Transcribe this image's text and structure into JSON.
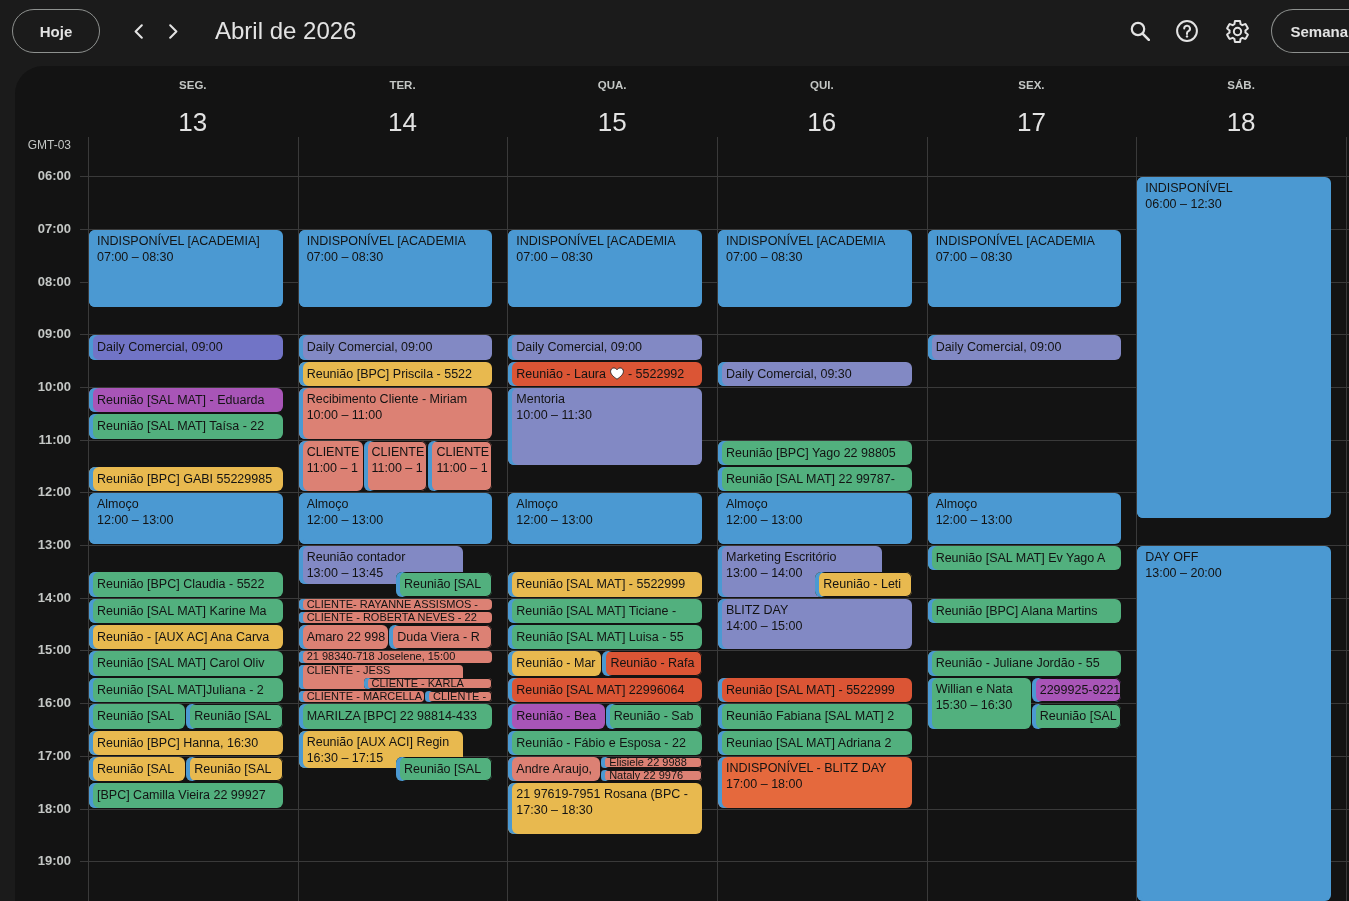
{
  "toolbar": {
    "today_button": "Hoje",
    "title": "Abril de 2026",
    "view_button": "Semana"
  },
  "timezone": "GMT-03",
  "time_labels": [
    "06:00",
    "07:00",
    "08:00",
    "09:00",
    "10:00",
    "11:00",
    "12:00",
    "13:00",
    "14:00",
    "15:00",
    "16:00",
    "17:00",
    "18:00",
    "19:00"
  ],
  "days": [
    {
      "weekday": "SEG.",
      "date": "13",
      "items": [
        {
          "kind": "free-hour"
        },
        {
          "kind": "hour-and-half",
          "title": "INDISPONÍVEL [ACADEMIA]",
          "time": "07:00 – 08:30",
          "color": "#4b99d2"
        },
        {
          "kind": "free-half-hour"
        },
        {
          "kind": "half-hour",
          "title": "Daily Comercial, 09:00",
          "color": "#7174c6"
        },
        {
          "kind": "free-half-hour"
        },
        {
          "kind": "half-hour",
          "title": "Reunião [SAL MAT] - Eduarda",
          "color": "#a855b7"
        },
        {
          "kind": "half-hour",
          "title": "Reunião [SAL MAT] Taísa - 22",
          "color": "#52b07e"
        },
        {
          "kind": "free-half-hour"
        },
        {
          "kind": "half-hour",
          "title": "Reunião [BPC] GABI 55229985",
          "color": "#e8b94f"
        },
        {
          "kind": "hour",
          "title": "Almoço",
          "time": "12:00 – 13:00",
          "color": "#4b99d2"
        },
        {
          "kind": "free-half-hour"
        },
        {
          "kind": "half-hour",
          "title": "Reunião [BPC] Claudia - 5522",
          "color": "#52b07e"
        },
        {
          "kind": "half-hour",
          "title": "Reunião [SAL MAT] Karine Ma",
          "color": "#52b07e"
        },
        {
          "kind": "half-hour",
          "title": "Reunião - [AUX AC] Ana Carva",
          "color": "#e8b94f"
        },
        {
          "kind": "half-hour",
          "title": "Reunião [SAL MAT] Carol Oliv",
          "color": "#52b07e"
        },
        {
          "kind": "half-hour",
          "title": "Reunião [SAL MAT]Juliana - 2",
          "color": "#52b07e"
        },
        {
          "kind": "overlap",
          "lanes": [
            [
              {
                "kind": "half-hour",
                "title": "Reunião [SAL",
                "color": "#52b07e"
              }
            ],
            [
              {
                "kind": "half-hour",
                "title": "Reunião [SAL",
                "color": "#52b07e"
              }
            ]
          ]
        },
        {
          "kind": "half-hour",
          "title": "Reunião [BPC] Hanna, 16:30",
          "color": "#e8b94f"
        },
        {
          "kind": "overlap",
          "lanes": [
            [
              {
                "kind": "half-hour",
                "title": "Reunião [SAL",
                "color": "#e8b94f"
              }
            ],
            [
              {
                "kind": "half-hour",
                "title": "Reunião [SAL",
                "color": "#e8b94f"
              }
            ]
          ]
        },
        {
          "kind": "half-hour",
          "title": "[BPC] Camilla Vieira 22 99927",
          "color": "#52b07e"
        }
      ]
    },
    {
      "weekday": "TER.",
      "date": "14",
      "items": [
        {
          "kind": "free-hour"
        },
        {
          "kind": "hour-and-half",
          "title": "INDISPONÍVEL [ACADEMIA",
          "time": "07:00 – 08:30",
          "color": "#4b99d2"
        },
        {
          "kind": "free-half-hour"
        },
        {
          "kind": "half-hour",
          "title": "Daily Comercial, 09:00",
          "color": "#8289c4"
        },
        {
          "kind": "half-hour",
          "title": "Reunião [BPC] Priscila - 5522",
          "color": "#e8b94f"
        },
        {
          "kind": "hour",
          "title": "Recibimento Cliente - Miriam",
          "time": "10:00 – 11:00",
          "color": "#dc8174"
        },
        {
          "kind": "overlap",
          "lanes": [
            [
              {
                "kind": "hour",
                "title": "CLIENTE",
                "time": "11:00 – 1",
                "color": "#dc8174"
              }
            ],
            [
              {
                "kind": "hour",
                "title": "CLIENTE",
                "time": "11:00 – 1",
                "color": "#dc8174"
              }
            ],
            [
              {
                "kind": "hour",
                "title": "CLIENTE",
                "time": "11:00 – 1",
                "color": "#dc8174"
              }
            ]
          ]
        },
        {
          "kind": "hour",
          "title": "Almoço",
          "time": "12:00 – 13:00",
          "color": "#4b99d2"
        },
        {
          "kind": "overlap",
          "lanes": [
            [
              {
                "kind": "three-quarter-hour",
                "title": "Reunião contador",
                "time": "13:00 – 13:45",
                "color": "#8289c4"
              }
            ],
            [
              {
                "kind": "free-half-hour"
              },
              {
                "kind": "half-hour",
                "title": "Reunião [SAL",
                "color": "#52b07e"
              }
            ]
          ]
        },
        {
          "kind": "quarter-hour",
          "title": "CLIENTE- RAYANNE ASSISMOS -",
          "color": "#dc8174"
        },
        {
          "kind": "quarter-hour",
          "title": "CLIENTE - ROBERTA NEVES - 22",
          "color": "#dc8174"
        },
        {
          "kind": "overlap",
          "lanes": [
            [
              {
                "kind": "half-hour",
                "title": "Amaro 22 998",
                "color": "#dc8174"
              }
            ],
            [
              {
                "kind": "half-hour",
                "title": "Duda Viera - R",
                "color": "#dc8174"
              }
            ]
          ]
        },
        {
          "kind": "quarter-hour",
          "title": "21 98340-718 Joselene, 15:00",
          "color": "#dc8174"
        },
        {
          "kind": "overlap",
          "lanes": [
            [
              {
                "kind": "half-hour",
                "title": "CLIENTE - JESS",
                "color": "#dc8174"
              }
            ],
            [
              {
                "kind": "free-quarter-hour"
              },
              {
                "kind": "quarter-hour",
                "title": "CLIENTE - KARLA",
                "color": "#dc8174"
              }
            ]
          ]
        },
        {
          "kind": "overlap",
          "lanes": [
            [
              {
                "kind": "quarter-hour",
                "title": "CLIENTE - MARCELLA",
                "color": "#dc8174"
              }
            ],
            [
              {
                "kind": "quarter-hour",
                "title": "CLIENTE -",
                "color": "#dc8174"
              }
            ]
          ]
        },
        {
          "kind": "half-hour",
          "title": "MARILZA [BPC] 22 98814-433",
          "color": "#52b07e"
        },
        {
          "kind": "overlap",
          "lanes": [
            [
              {
                "kind": "three-quarter-hour",
                "title": "Reunião [AUX ACI] Regin",
                "time": "16:30 – 17:15",
                "color": "#e8b94f"
              }
            ],
            [
              {
                "kind": "free-half-hour"
              },
              {
                "kind": "half-hour",
                "title": "Reunião [SAL",
                "color": "#52b07e"
              }
            ]
          ]
        }
      ]
    },
    {
      "weekday": "QUA.",
      "date": "15",
      "items": [
        {
          "kind": "free-hour"
        },
        {
          "kind": "hour-and-half",
          "title": "INDISPONÍVEL [ACADEMIA",
          "time": "07:00 – 08:30",
          "color": "#4b99d2"
        },
        {
          "kind": "free-half-hour"
        },
        {
          "kind": "half-hour",
          "title": "Daily Comercial, 09:00",
          "color": "#8289c4"
        },
        {
          "kind": "half-hour",
          "title": "Reunião - Laura",
          "title_icon": true,
          "title_end": "- 5522992",
          "color": "#db5535"
        },
        {
          "kind": "hour-and-half",
          "title": "Mentoria",
          "time": "10:00 – 11:30",
          "color": "#8289c4"
        },
        {
          "kind": "free-half-hour"
        },
        {
          "kind": "hour",
          "title": "Almoço",
          "time": "12:00 – 13:00",
          "color": "#4b99d2"
        },
        {
          "kind": "free-half-hour"
        },
        {
          "kind": "half-hour",
          "title": "Reunião [SAL MAT] - 5522999",
          "color": "#e8b94f"
        },
        {
          "kind": "half-hour",
          "title": "Reunião [SAL MAT] Ticiane -",
          "color": "#52b07e"
        },
        {
          "kind": "half-hour",
          "title": "Reunião [SAL MAT] Luisa - 55",
          "color": "#52b07e"
        },
        {
          "kind": "overlap",
          "lanes": [
            [
              {
                "kind": "half-hour",
                "title": "Reunião - Mar",
                "color": "#e8b94f"
              }
            ],
            [
              {
                "kind": "half-hour",
                "title": "Reunião - Rafa",
                "color": "#db5535"
              }
            ]
          ]
        },
        {
          "kind": "half-hour",
          "title": "Reunião [SAL MAT] 22996064",
          "color": "#db5535"
        },
        {
          "kind": "overlap",
          "lanes": [
            [
              {
                "kind": "half-hour",
                "title": "Reunião - Bea",
                "color": "#a855b7"
              }
            ],
            [
              {
                "kind": "half-hour",
                "title": "Reunião - Sab",
                "color": "#52b07e"
              }
            ]
          ]
        },
        {
          "kind": "half-hour",
          "title": "Reunião - Fábio e Esposa - 22",
          "color": "#52b07e"
        },
        {
          "kind": "overlap",
          "lanes": [
            [
              {
                "kind": "half-hour",
                "title": "Andre Araujo,",
                "color": "#dc8174"
              }
            ],
            [
              {
                "kind": "quarter-hour",
                "title": "Elisiele 22 9988",
                "color": "#dc8174"
              },
              {
                "kind": "quarter-hour",
                "title": "Nataly 22 9976",
                "color": "#dc8174"
              }
            ]
          ]
        },
        {
          "kind": "hour",
          "title": "21 97619-7951 Rosana (BPC -",
          "time": "17:30 – 18:30",
          "color": "#e8b94f"
        }
      ]
    },
    {
      "weekday": "QUI.",
      "date": "16",
      "items": [
        {
          "kind": "free-hour"
        },
        {
          "kind": "hour-and-half",
          "title": "INDISPONÍVEL [ACADEMIA",
          "time": "07:00 – 08:30",
          "color": "#4b99d2"
        },
        {
          "kind": "free-hour"
        },
        {
          "kind": "half-hour",
          "title": "Daily Comercial, 09:30",
          "color": "#8289c4"
        },
        {
          "kind": "free-hour"
        },
        {
          "kind": "half-hour",
          "title": "Reunião [BPC] Yago 22 98805",
          "color": "#52b07e"
        },
        {
          "kind": "half-hour",
          "title": "Reunião [SAL MAT] 22 99787-",
          "color": "#52b07e"
        },
        {
          "kind": "hour",
          "title": "Almoço",
          "time": "12:00 – 13:00",
          "color": "#4b99d2"
        },
        {
          "kind": "overlap",
          "lanes": [
            [
              {
                "kind": "hour",
                "title": "Marketing Escritório",
                "time": "13:00 – 14:00",
                "color": "#8289c4"
              }
            ],
            [
              {
                "kind": "free-half-hour"
              },
              {
                "kind": "half-hour",
                "title": "Reunião - Leti",
                "color": "#e8b94f"
              }
            ]
          ]
        },
        {
          "kind": "hour",
          "title": "BLITZ DAY",
          "time": "14:00 – 15:00",
          "color": "#8289c4"
        },
        {
          "kind": "free-half-hour"
        },
        {
          "kind": "half-hour",
          "title": "Reunião [SAL MAT] - 5522999",
          "color": "#db5535"
        },
        {
          "kind": "half-hour",
          "title": "Reunião Fabiana [SAL MAT] 2",
          "color": "#52b07e"
        },
        {
          "kind": "half-hour",
          "title": "Reuniao [SAL MAT] Adriana 2",
          "color": "#52b07e"
        },
        {
          "kind": "hour",
          "title": "INDISPONÍVEL - BLITZ DAY",
          "time": "17:00 – 18:00",
          "color": "#e5693d"
        }
      ]
    },
    {
      "weekday": "SEX.",
      "date": "17",
      "items": [
        {
          "kind": "free-hour"
        },
        {
          "kind": "hour-and-half",
          "title": "INDISPONÍVEL [ACADEMIA",
          "time": "07:00 – 08:30",
          "color": "#4b99d2"
        },
        {
          "kind": "free-half-hour"
        },
        {
          "kind": "half-hour",
          "title": "Daily Comercial, 09:00",
          "color": "#8289c4"
        },
        {
          "kind": "free-two-and-half-hours"
        },
        {
          "kind": "hour",
          "title": "Almoço",
          "time": "12:00 – 13:00",
          "color": "#4b99d2"
        },
        {
          "kind": "half-hour",
          "title": "Reunião [SAL MAT] Ev Yago A",
          "color": "#52b07e"
        },
        {
          "kind": "free-half-hour"
        },
        {
          "kind": "half-hour",
          "title": "Reunião [BPC] Alana Martins",
          "color": "#52b07e"
        },
        {
          "kind": "free-half-hour"
        },
        {
          "kind": "half-hour",
          "title": "Reunião - Juliane Jordão - 55",
          "color": "#52b07e"
        },
        {
          "kind": "overlap",
          "lanes": [
            [
              {
                "kind": "hour",
                "title": "Willian e Nata",
                "time": "15:30 – 16:30",
                "color": "#52b07e"
              }
            ],
            [
              {
                "kind": "half-hour",
                "title": "2299925-9221",
                "color": "#a855b7"
              },
              {
                "kind": "half-hour",
                "title": "Reunião [SAL",
                "color": "#52b07e"
              }
            ]
          ]
        }
      ]
    },
    {
      "weekday": "SÁB.",
      "date": "18",
      "items": [
        {
          "kind": "six-and-half-hours",
          "title": "INDISPONÍVEL",
          "time": "06:00 – 12:30",
          "color": "#4b99d2"
        },
        {
          "kind": "free-half-hour"
        },
        {
          "kind": "seven-hours",
          "title": "DAY OFF",
          "time": "13:00 – 20:00",
          "color": "#4b99d2"
        }
      ]
    }
  ]
}
